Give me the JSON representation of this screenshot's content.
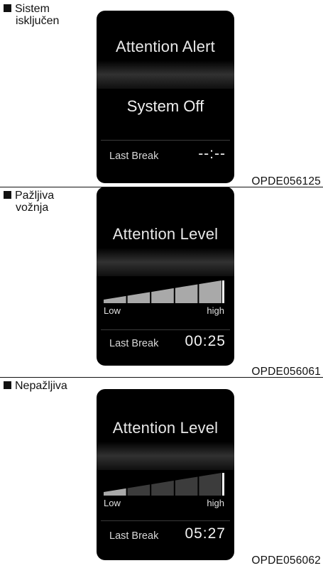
{
  "sections": [
    {
      "caption": [
        "Sistem",
        "isključen"
      ],
      "title": "Attention Alert",
      "status_text": "System Off",
      "last_break_label": "Last Break",
      "last_break_value": "--:--",
      "figure_code": "OPDE056125"
    },
    {
      "caption": [
        "Pažljiva",
        "vožnja"
      ],
      "title": "Attention Level",
      "level": {
        "low_label": "Low",
        "high_label": "high",
        "filled_segments": 5,
        "total_segments": 5
      },
      "last_break_label": "Last Break",
      "last_break_value": "00:25",
      "figure_code": "OPDE056061"
    },
    {
      "caption": [
        "Nepažljiva"
      ],
      "title": "Attention Level",
      "level": {
        "low_label": "Low",
        "high_label": "high",
        "filled_segments": 1,
        "total_segments": 5
      },
      "last_break_label": "Last Break",
      "last_break_value": "05:27",
      "figure_code": "OPDE056062"
    }
  ],
  "colors": {
    "segment_filled": "#a9a9a9",
    "segment_empty": "#3c3c3c",
    "marker": "#ffffff"
  }
}
